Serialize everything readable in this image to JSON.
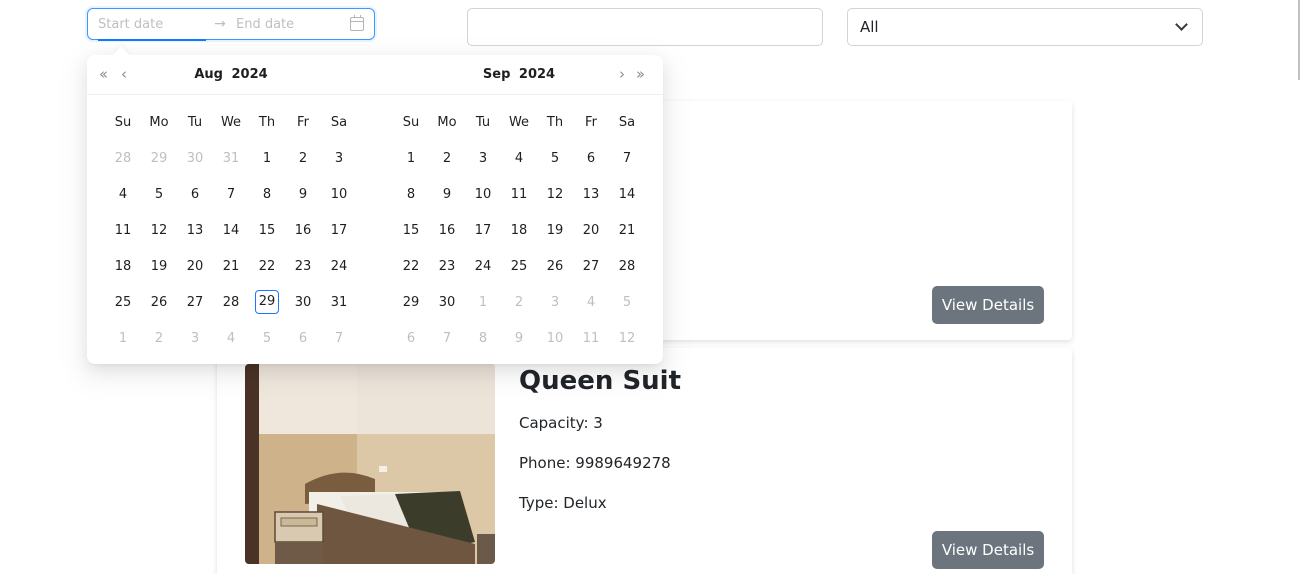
{
  "filters": {
    "start_placeholder": "Start date",
    "separator": "→",
    "end_placeholder": "End date",
    "text_value": "",
    "select_value": "All"
  },
  "calendar": {
    "left": {
      "month": "Aug",
      "year": "2024",
      "weekdays": [
        "Su",
        "Mo",
        "Tu",
        "We",
        "Th",
        "Fr",
        "Sa"
      ],
      "weeks": [
        [
          {
            "d": "28",
            "out": true
          },
          {
            "d": "29",
            "out": true
          },
          {
            "d": "30",
            "out": true
          },
          {
            "d": "31",
            "out": true
          },
          {
            "d": "1"
          },
          {
            "d": "2"
          },
          {
            "d": "3"
          }
        ],
        [
          {
            "d": "4"
          },
          {
            "d": "5"
          },
          {
            "d": "6"
          },
          {
            "d": "7"
          },
          {
            "d": "8"
          },
          {
            "d": "9"
          },
          {
            "d": "10"
          }
        ],
        [
          {
            "d": "11"
          },
          {
            "d": "12"
          },
          {
            "d": "13"
          },
          {
            "d": "14"
          },
          {
            "d": "15"
          },
          {
            "d": "16"
          },
          {
            "d": "17"
          }
        ],
        [
          {
            "d": "18"
          },
          {
            "d": "19"
          },
          {
            "d": "20"
          },
          {
            "d": "21"
          },
          {
            "d": "22"
          },
          {
            "d": "23"
          },
          {
            "d": "24"
          }
        ],
        [
          {
            "d": "25"
          },
          {
            "d": "26"
          },
          {
            "d": "27"
          },
          {
            "d": "28"
          },
          {
            "d": "29",
            "today": true
          },
          {
            "d": "30"
          },
          {
            "d": "31"
          }
        ],
        [
          {
            "d": "1",
            "out": true
          },
          {
            "d": "2",
            "out": true
          },
          {
            "d": "3",
            "out": true
          },
          {
            "d": "4",
            "out": true
          },
          {
            "d": "5",
            "out": true
          },
          {
            "d": "6",
            "out": true
          },
          {
            "d": "7",
            "out": true
          }
        ]
      ]
    },
    "right": {
      "month": "Sep",
      "year": "2024",
      "weekdays": [
        "Su",
        "Mo",
        "Tu",
        "We",
        "Th",
        "Fr",
        "Sa"
      ],
      "weeks": [
        [
          {
            "d": "1"
          },
          {
            "d": "2"
          },
          {
            "d": "3"
          },
          {
            "d": "4"
          },
          {
            "d": "5"
          },
          {
            "d": "6"
          },
          {
            "d": "7"
          }
        ],
        [
          {
            "d": "8"
          },
          {
            "d": "9"
          },
          {
            "d": "10"
          },
          {
            "d": "11"
          },
          {
            "d": "12"
          },
          {
            "d": "13"
          },
          {
            "d": "14"
          }
        ],
        [
          {
            "d": "15"
          },
          {
            "d": "16"
          },
          {
            "d": "17"
          },
          {
            "d": "18"
          },
          {
            "d": "19"
          },
          {
            "d": "20"
          },
          {
            "d": "21"
          }
        ],
        [
          {
            "d": "22"
          },
          {
            "d": "23"
          },
          {
            "d": "24"
          },
          {
            "d": "25"
          },
          {
            "d": "26"
          },
          {
            "d": "27"
          },
          {
            "d": "28"
          }
        ],
        [
          {
            "d": "29"
          },
          {
            "d": "30"
          },
          {
            "d": "1",
            "out": true
          },
          {
            "d": "2",
            "out": true
          },
          {
            "d": "3",
            "out": true
          },
          {
            "d": "4",
            "out": true
          },
          {
            "d": "5",
            "out": true
          }
        ],
        [
          {
            "d": "6",
            "out": true
          },
          {
            "d": "7",
            "out": true
          },
          {
            "d": "8",
            "out": true
          },
          {
            "d": "9",
            "out": true
          },
          {
            "d": "10",
            "out": true
          },
          {
            "d": "11",
            "out": true
          },
          {
            "d": "12",
            "out": true
          }
        ]
      ]
    }
  },
  "rooms": [
    {
      "peek_text": ":",
      "button_label": "View Details"
    },
    {
      "name": "Queen Suit",
      "capacity": "Capacity: 3",
      "phone": "Phone: 9989649278",
      "type": "Type: Delux",
      "button_label": "View Details"
    }
  ]
}
